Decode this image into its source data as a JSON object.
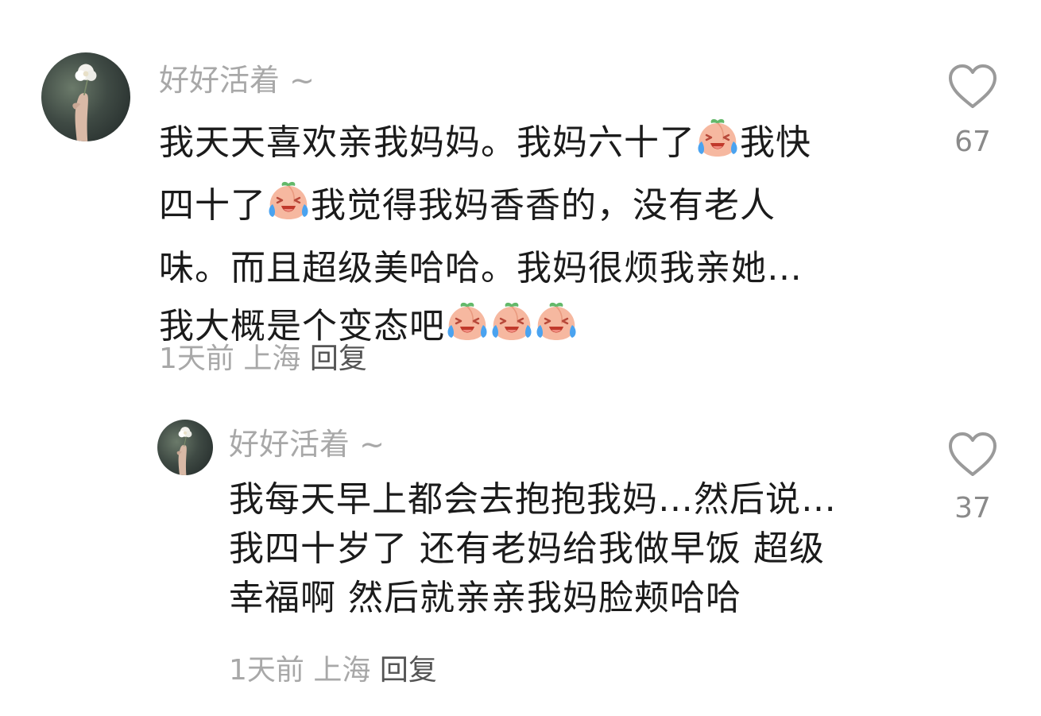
{
  "comments": [
    {
      "username": "好好活着 ~",
      "lines": [
        "我天天喜欢亲我妈妈。我妈六十了",
        "我快",
        "四十了",
        "我觉得我妈香香的，没有老人",
        "味。而且超级美哈哈。我妈很烦我亲她…",
        "我大概是个变态吧"
      ],
      "time": "1天前",
      "location": "上海",
      "reply_label": "回复",
      "likes": "67",
      "emoji": "crying-laughing-peach-emoji"
    },
    {
      "username": "好好活着 ~",
      "lines": [
        "我每天早上都会去抱抱我妈…然后说…",
        "我四十岁了 还有老妈给我做早饭 超级",
        "幸福啊 然后就亲亲我妈脸颊哈哈"
      ],
      "time": "1天前",
      "location": "上海",
      "reply_label": "回复",
      "likes": "37"
    }
  ],
  "colors": {
    "text": "#1b1b1b",
    "muted": "#a8a8a8",
    "reply": "#555555",
    "heart": "#9a9a9a",
    "emoji_face": "#f6b8a0",
    "emoji_tear": "#4aa3f0"
  }
}
